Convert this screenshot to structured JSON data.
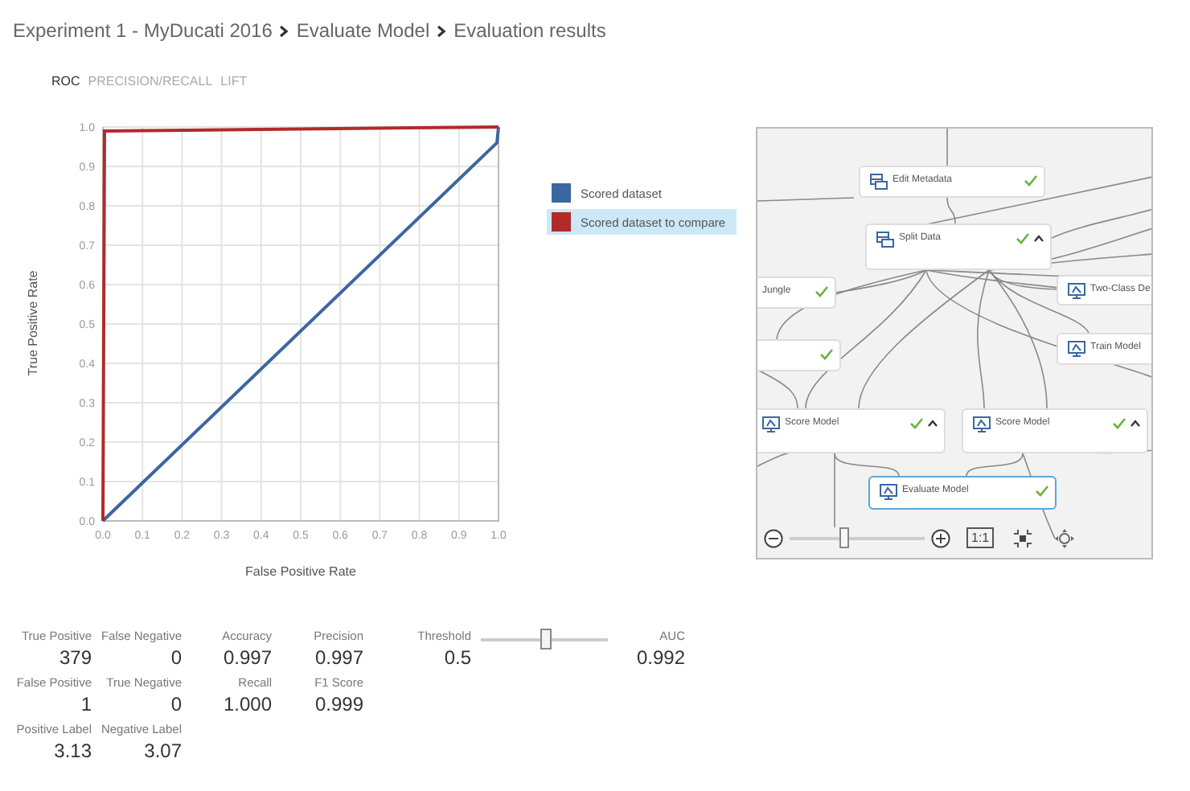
{
  "breadcrumb": [
    "Experiment 1 - MyDucati 2016",
    "Evaluate Model",
    "Evaluation results"
  ],
  "tabs": [
    {
      "label": "ROC",
      "selected": true
    },
    {
      "label": "PRECISION/RECALL",
      "selected": false
    },
    {
      "label": "LIFT",
      "selected": false
    }
  ],
  "roc_chart": {
    "chart_data": {
      "type": "line",
      "xlabel": "False Positive Rate",
      "ylabel": "True Positive Rate",
      "x": [
        0,
        0.004,
        0.996,
        1
      ],
      "series": [
        {
          "name": "Scored dataset",
          "color": "#3b67a0",
          "values": [
            0,
            0.004,
            0.96,
            1
          ]
        },
        {
          "name": "Scored dataset to compare",
          "color": "#b22a2a",
          "values": [
            0,
            0.99,
            1,
            1
          ]
        }
      ],
      "xlim": [
        0,
        1
      ],
      "ylim": [
        0,
        1
      ],
      "grid": true,
      "xticks": [
        {
          "value": 0,
          "label": "0.0"
        },
        {
          "value": 0.1,
          "label": "0.1"
        },
        {
          "value": 0.2,
          "label": "0.2"
        },
        {
          "value": 0.3,
          "label": "0.3"
        },
        {
          "value": 0.4,
          "label": "0.4"
        },
        {
          "value": 0.5,
          "label": "0.5"
        },
        {
          "value": 0.6,
          "label": "0.6"
        },
        {
          "value": 0.7,
          "label": "0.7"
        },
        {
          "value": 0.8,
          "label": "0.8"
        },
        {
          "value": 0.9,
          "label": "0.9"
        },
        {
          "value": 1,
          "label": "1.0"
        }
      ],
      "yticks": [
        {
          "value": 0,
          "label": "0.0"
        },
        {
          "value": 0.1,
          "label": "0.1"
        },
        {
          "value": 0.2,
          "label": "0.2"
        },
        {
          "value": 0.3,
          "label": "0.3"
        },
        {
          "value": 0.4,
          "label": "0.4"
        },
        {
          "value": 0.5,
          "label": "0.5"
        },
        {
          "value": 0.6,
          "label": "0.6"
        },
        {
          "value": 0.7,
          "label": "0.7"
        },
        {
          "value": 0.8,
          "label": "0.8"
        },
        {
          "value": 0.9,
          "label": "0.9"
        },
        {
          "value": 1,
          "label": "1.0"
        }
      ]
    },
    "legend": [
      {
        "selected": false
      },
      {
        "selected": true
      }
    ]
  },
  "experiment_canvas": {
    "nodes": [
      {
        "label": "Edit Metadata",
        "kind": "data",
        "completed": true,
        "collapsible": false,
        "selected": false
      },
      {
        "label": "Split Data",
        "kind": "data",
        "completed": true,
        "collapsible": true,
        "selected": false
      },
      {
        "label": "Jungle",
        "kind": "clipped",
        "completed": true,
        "collapsible": false,
        "selected": false
      },
      {
        "kind": "clipped",
        "completed": true,
        "collapsible": false,
        "selected": false
      },
      {
        "label": "Two-Class De",
        "kind": "model",
        "selected": false
      },
      {
        "label": "Train Model",
        "kind": "model",
        "selected": false
      },
      {
        "label": "Score Model",
        "kind": "model",
        "completed": true,
        "collapsible": true,
        "selected": false
      },
      {
        "label": "Score Model",
        "kind": "model",
        "completed": true,
        "collapsible": true,
        "selected": false
      },
      {
        "label": "Evaluate Model",
        "kind": "model",
        "completed": true,
        "collapsible": false,
        "selected": true
      }
    ],
    "zoom": {
      "level": 0.41
    },
    "actual_size_label": "1:1"
  },
  "metrics": [
    [
      {
        "kind": "stat",
        "label": "True Positive",
        "value": "379"
      },
      {
        "kind": "stat",
        "label": "False Negative",
        "value": "0"
      },
      {
        "kind": "stat",
        "label": "Accuracy",
        "value": "0.997"
      },
      {
        "kind": "stat",
        "label": "Precision",
        "value": "0.997"
      },
      {
        "kind": "threshold",
        "label": "Threshold",
        "value": "0.5",
        "level": 0.5
      },
      {
        "kind": "stat",
        "label": "AUC",
        "value": "0.992"
      }
    ],
    [
      {
        "kind": "stat",
        "label": "False Positive",
        "value": "1"
      },
      {
        "kind": "stat",
        "label": "True Negative",
        "value": "0"
      },
      {
        "kind": "stat",
        "label": "Recall",
        "value": "1.000"
      },
      {
        "kind": "stat",
        "label": "F1 Score",
        "value": "0.999"
      }
    ],
    [
      {
        "kind": "stat",
        "label": "Positive Label",
        "value": "3.13"
      },
      {
        "kind": "stat",
        "label": "Negative Label",
        "value": "3.07"
      }
    ]
  ]
}
